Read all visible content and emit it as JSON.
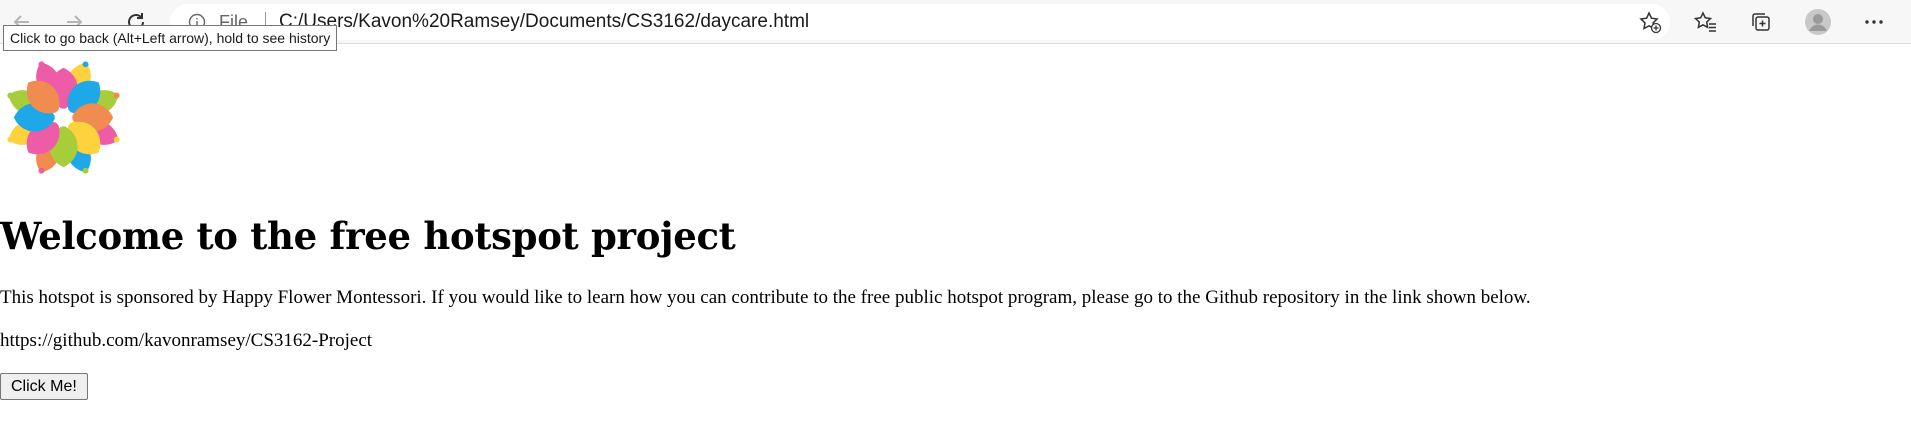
{
  "browser": {
    "address_scheme": "File",
    "address_url": "C:/Users/Kavon%20Ramsey/Documents/CS3162/daycare.html",
    "tooltip": "Click to go back (Alt+Left arrow), hold to see history"
  },
  "page": {
    "title": "Welcome to the free hotspot project",
    "paragraph": "This hotspot is sponsored by Happy Flower Montessori. If you would like to learn how you can contribute to the free public hotspot program, please go to the Github repository in the link shown below.",
    "repo_link": "https://github.com/kavonramsey/CS3162-Project",
    "button_label": "Click Me!"
  },
  "icons": [
    "back-icon",
    "forward-icon",
    "refresh-icon",
    "info-icon",
    "add-favorite-icon",
    "favorites-icon",
    "collections-icon",
    "profile-icon",
    "more-icon"
  ],
  "colors": {
    "petal_pink": "#ee5ba6",
    "petal_blue": "#1fa8e8",
    "petal_orange": "#f08c50",
    "petal_yellow": "#fdd23c",
    "petal_green": "#a7cd3b"
  }
}
